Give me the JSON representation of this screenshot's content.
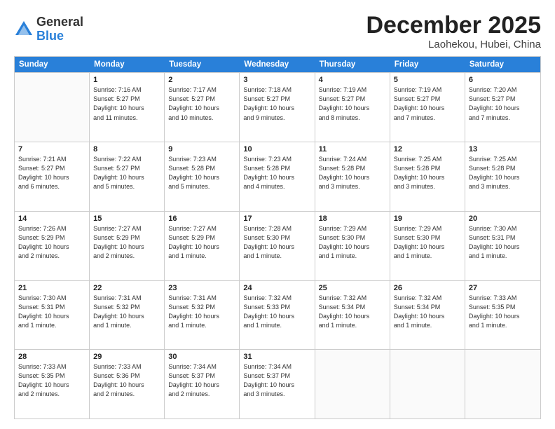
{
  "logo": {
    "general": "General",
    "blue": "Blue"
  },
  "title": "December 2025",
  "location": "Laohekou, Hubei, China",
  "header_days": [
    "Sunday",
    "Monday",
    "Tuesday",
    "Wednesday",
    "Thursday",
    "Friday",
    "Saturday"
  ],
  "weeks": [
    [
      {
        "day": "",
        "info": ""
      },
      {
        "day": "1",
        "info": "Sunrise: 7:16 AM\nSunset: 5:27 PM\nDaylight: 10 hours\nand 11 minutes."
      },
      {
        "day": "2",
        "info": "Sunrise: 7:17 AM\nSunset: 5:27 PM\nDaylight: 10 hours\nand 10 minutes."
      },
      {
        "day": "3",
        "info": "Sunrise: 7:18 AM\nSunset: 5:27 PM\nDaylight: 10 hours\nand 9 minutes."
      },
      {
        "day": "4",
        "info": "Sunrise: 7:19 AM\nSunset: 5:27 PM\nDaylight: 10 hours\nand 8 minutes."
      },
      {
        "day": "5",
        "info": "Sunrise: 7:19 AM\nSunset: 5:27 PM\nDaylight: 10 hours\nand 7 minutes."
      },
      {
        "day": "6",
        "info": "Sunrise: 7:20 AM\nSunset: 5:27 PM\nDaylight: 10 hours\nand 7 minutes."
      }
    ],
    [
      {
        "day": "7",
        "info": "Sunrise: 7:21 AM\nSunset: 5:27 PM\nDaylight: 10 hours\nand 6 minutes."
      },
      {
        "day": "8",
        "info": "Sunrise: 7:22 AM\nSunset: 5:27 PM\nDaylight: 10 hours\nand 5 minutes."
      },
      {
        "day": "9",
        "info": "Sunrise: 7:23 AM\nSunset: 5:28 PM\nDaylight: 10 hours\nand 5 minutes."
      },
      {
        "day": "10",
        "info": "Sunrise: 7:23 AM\nSunset: 5:28 PM\nDaylight: 10 hours\nand 4 minutes."
      },
      {
        "day": "11",
        "info": "Sunrise: 7:24 AM\nSunset: 5:28 PM\nDaylight: 10 hours\nand 3 minutes."
      },
      {
        "day": "12",
        "info": "Sunrise: 7:25 AM\nSunset: 5:28 PM\nDaylight: 10 hours\nand 3 minutes."
      },
      {
        "day": "13",
        "info": "Sunrise: 7:25 AM\nSunset: 5:28 PM\nDaylight: 10 hours\nand 3 minutes."
      }
    ],
    [
      {
        "day": "14",
        "info": "Sunrise: 7:26 AM\nSunset: 5:29 PM\nDaylight: 10 hours\nand 2 minutes."
      },
      {
        "day": "15",
        "info": "Sunrise: 7:27 AM\nSunset: 5:29 PM\nDaylight: 10 hours\nand 2 minutes."
      },
      {
        "day": "16",
        "info": "Sunrise: 7:27 AM\nSunset: 5:29 PM\nDaylight: 10 hours\nand 1 minute."
      },
      {
        "day": "17",
        "info": "Sunrise: 7:28 AM\nSunset: 5:30 PM\nDaylight: 10 hours\nand 1 minute."
      },
      {
        "day": "18",
        "info": "Sunrise: 7:29 AM\nSunset: 5:30 PM\nDaylight: 10 hours\nand 1 minute."
      },
      {
        "day": "19",
        "info": "Sunrise: 7:29 AM\nSunset: 5:30 PM\nDaylight: 10 hours\nand 1 minute."
      },
      {
        "day": "20",
        "info": "Sunrise: 7:30 AM\nSunset: 5:31 PM\nDaylight: 10 hours\nand 1 minute."
      }
    ],
    [
      {
        "day": "21",
        "info": "Sunrise: 7:30 AM\nSunset: 5:31 PM\nDaylight: 10 hours\nand 1 minute."
      },
      {
        "day": "22",
        "info": "Sunrise: 7:31 AM\nSunset: 5:32 PM\nDaylight: 10 hours\nand 1 minute."
      },
      {
        "day": "23",
        "info": "Sunrise: 7:31 AM\nSunset: 5:32 PM\nDaylight: 10 hours\nand 1 minute."
      },
      {
        "day": "24",
        "info": "Sunrise: 7:32 AM\nSunset: 5:33 PM\nDaylight: 10 hours\nand 1 minute."
      },
      {
        "day": "25",
        "info": "Sunrise: 7:32 AM\nSunset: 5:34 PM\nDaylight: 10 hours\nand 1 minute."
      },
      {
        "day": "26",
        "info": "Sunrise: 7:32 AM\nSunset: 5:34 PM\nDaylight: 10 hours\nand 1 minute."
      },
      {
        "day": "27",
        "info": "Sunrise: 7:33 AM\nSunset: 5:35 PM\nDaylight: 10 hours\nand 1 minute."
      }
    ],
    [
      {
        "day": "28",
        "info": "Sunrise: 7:33 AM\nSunset: 5:35 PM\nDaylight: 10 hours\nand 2 minutes."
      },
      {
        "day": "29",
        "info": "Sunrise: 7:33 AM\nSunset: 5:36 PM\nDaylight: 10 hours\nand 2 minutes."
      },
      {
        "day": "30",
        "info": "Sunrise: 7:34 AM\nSunset: 5:37 PM\nDaylight: 10 hours\nand 2 minutes."
      },
      {
        "day": "31",
        "info": "Sunrise: 7:34 AM\nSunset: 5:37 PM\nDaylight: 10 hours\nand 3 minutes."
      },
      {
        "day": "",
        "info": ""
      },
      {
        "day": "",
        "info": ""
      },
      {
        "day": "",
        "info": ""
      }
    ]
  ]
}
